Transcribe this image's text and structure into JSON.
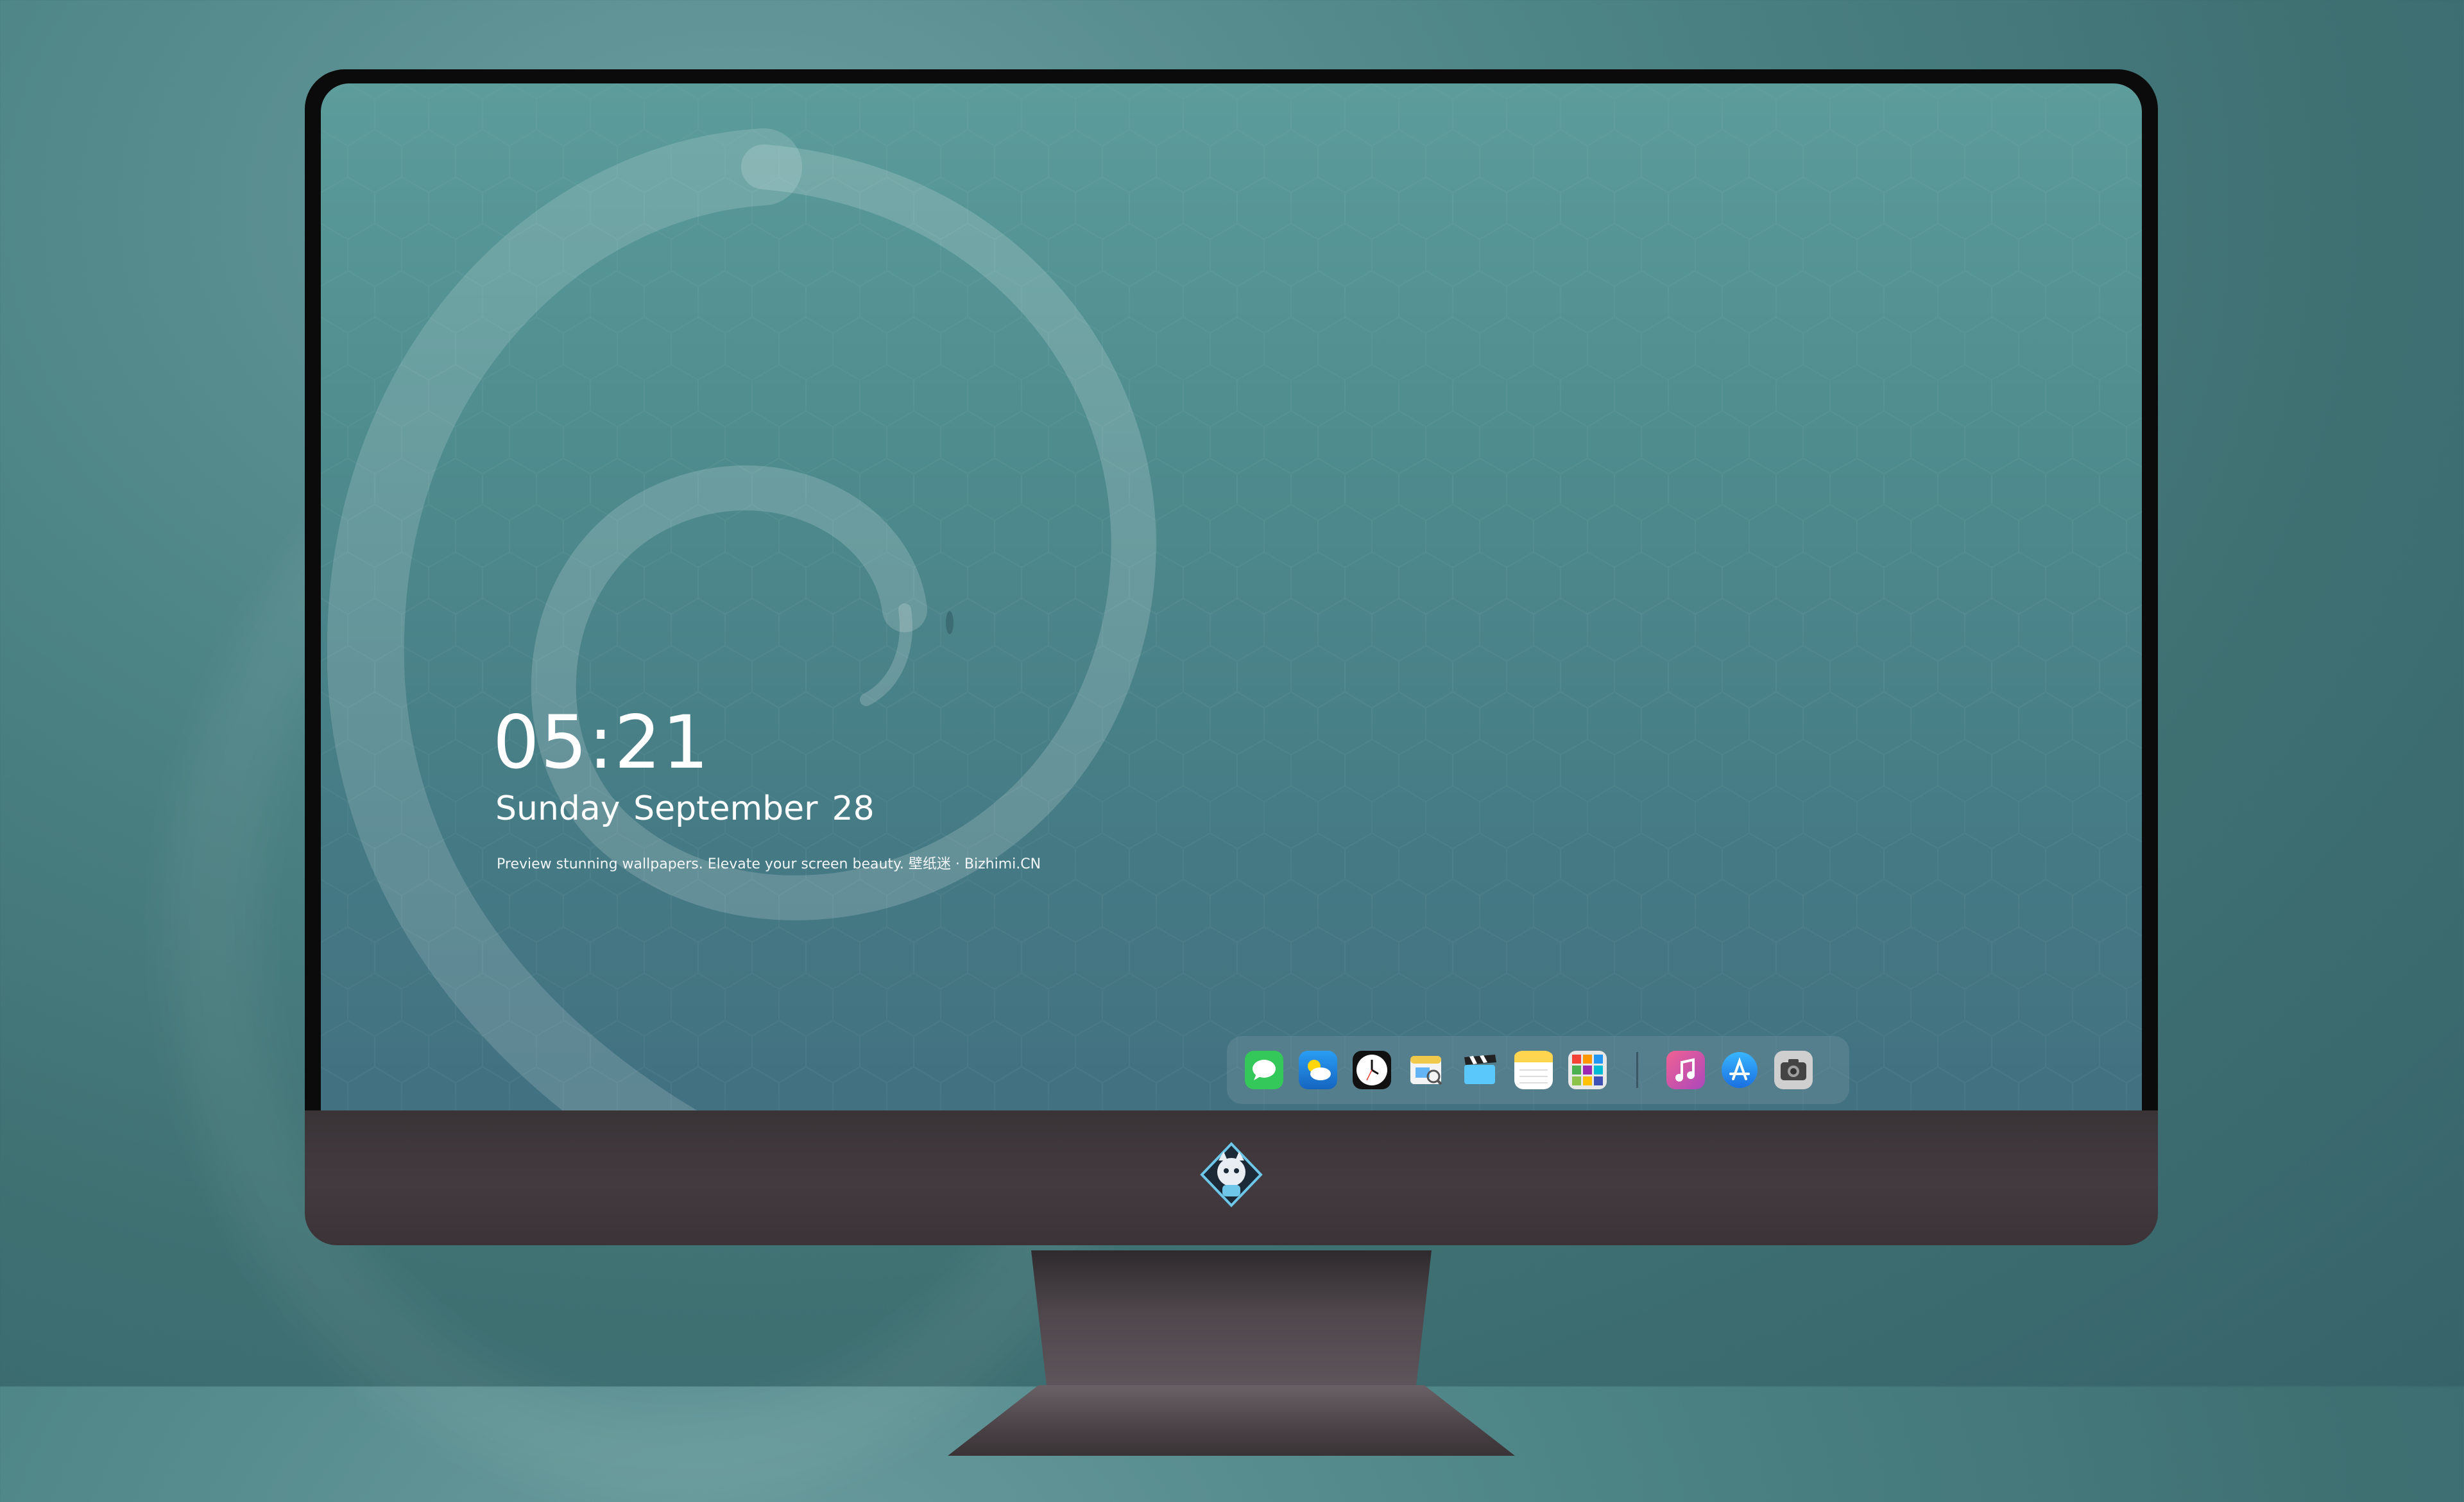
{
  "lockscreen": {
    "time": "05:21",
    "date_weekday_month": "Sunday September",
    "date_day": "28",
    "tagline": "Preview stunning wallpapers. Elevate your screen beauty. 壁纸迷 · Bizhimi.CN"
  },
  "dock": {
    "apps": [
      {
        "name": "messages-icon",
        "color": "#34c759"
      },
      {
        "name": "weather-icon",
        "color": "#1e90ff"
      },
      {
        "name": "clock-icon",
        "color": "#111111"
      },
      {
        "name": "preview-icon",
        "color": "#f0c94a"
      },
      {
        "name": "claquette-icon",
        "color": "#5ac8fa"
      },
      {
        "name": "notes-icon",
        "color": "#ffd54f"
      },
      {
        "name": "photos-grid-icon",
        "color": "#4caf50"
      },
      {
        "name": "itunes-icon",
        "color": "#d946ef"
      },
      {
        "name": "app-store-icon",
        "color": "#1a8cff"
      },
      {
        "name": "screenshot-camera-icon",
        "color": "#5a5a5a"
      }
    ]
  },
  "colors": {
    "wallpaper_top": "#5c9c9b",
    "wallpaper_bottom": "#427181",
    "bezel": "#0b0b0c",
    "chin": "#433a3f"
  }
}
